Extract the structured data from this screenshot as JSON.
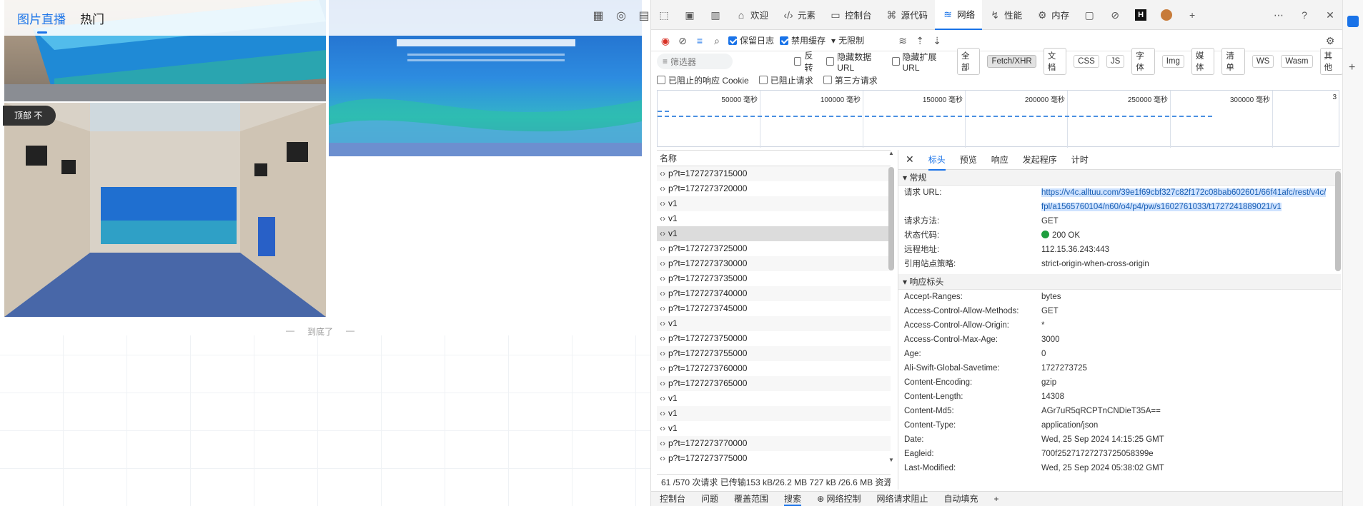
{
  "page": {
    "tabs": [
      {
        "label": "图片直播"
      },
      {
        "label": "热门"
      }
    ],
    "top_button": "顶部 不",
    "end_text": [
      "—",
      "到底了",
      "—"
    ]
  },
  "devtools": {
    "main_tabs": [
      {
        "label": "欢迎",
        "icon": "home-icon"
      },
      {
        "label": "元素",
        "icon": "code-icon"
      },
      {
        "label": "控制台",
        "icon": "console-icon"
      },
      {
        "label": "源代码",
        "icon": "sources-icon"
      },
      {
        "label": "网络",
        "icon": "wifi-icon"
      },
      {
        "label": "性能",
        "icon": "performance-icon"
      },
      {
        "label": "内存",
        "icon": "memory-icon"
      }
    ],
    "options": {
      "preserve_log": "保留日志",
      "disable_cache": "禁用缓存",
      "throttle": "无限制"
    },
    "filter_placeholder": "筛选器",
    "filter_checks": [
      "反转",
      "隐藏数据 URL",
      "隐藏扩展 URL"
    ],
    "type_chips": [
      "全部",
      "Fetch/XHR",
      "文档",
      "CSS",
      "JS",
      "字体",
      "Img",
      "媒体",
      "清单",
      "WS",
      "Wasm",
      "其他"
    ],
    "active_chip": "Fetch/XHR",
    "extra_checks": [
      "已阻止的响应 Cookie",
      "已阻止请求",
      "第三方请求"
    ],
    "timeline_ticks": [
      "50000 毫秒",
      "100000 毫秒",
      "150000 毫秒",
      "200000 毫秒",
      "250000 毫秒",
      "300000 毫秒",
      "3"
    ],
    "list_header": "名称",
    "requests": [
      "p?t=1727273715000",
      "p?t=1727273720000",
      "v1",
      "v1",
      "v1",
      "p?t=1727273725000",
      "p?t=1727273730000",
      "p?t=1727273735000",
      "p?t=1727273740000",
      "p?t=1727273745000",
      "v1",
      "p?t=1727273750000",
      "p?t=1727273755000",
      "p?t=1727273760000",
      "p?t=1727273765000",
      "v1",
      "v1",
      "v1",
      "p?t=1727273770000",
      "p?t=1727273775000"
    ],
    "selected_index": 4,
    "status_bar": "61 /570 次请求  已传输153 kB/26.2 MB  727 kB /26.6 MB 资源",
    "detail_tabs": [
      "标头",
      "预览",
      "响应",
      "发起程序",
      "计时"
    ],
    "general_title": "常规",
    "general": [
      {
        "k": "请求 URL:",
        "v": "https://v4c.alltuu.com/39e1f69cbf327c82f172c08bab602601/66f41afc/rest/v4c/fpl/a1565760104/n60/o4/p4/pw/s1602761033/t1727241889021/v1"
      },
      {
        "k": "请求方法:",
        "v": "GET"
      },
      {
        "k": "状态代码:",
        "v": "200 OK"
      },
      {
        "k": "远程地址:",
        "v": "112.15.36.243:443"
      },
      {
        "k": "引用站点策略:",
        "v": "strict-origin-when-cross-origin"
      }
    ],
    "response_title": "响应标头",
    "response": [
      {
        "k": "Accept-Ranges:",
        "v": "bytes"
      },
      {
        "k": "Access-Control-Allow-Methods:",
        "v": "GET"
      },
      {
        "k": "Access-Control-Allow-Origin:",
        "v": "*"
      },
      {
        "k": "Access-Control-Max-Age:",
        "v": "3000"
      },
      {
        "k": "Age:",
        "v": "0"
      },
      {
        "k": "Ali-Swift-Global-Savetime:",
        "v": "1727273725"
      },
      {
        "k": "Content-Encoding:",
        "v": "gzip"
      },
      {
        "k": "Content-Length:",
        "v": "14308"
      },
      {
        "k": "Content-Md5:",
        "v": "AGr7uR5qRCPTnCNDieT35A=="
      },
      {
        "k": "Content-Type:",
        "v": "application/json"
      },
      {
        "k": "Date:",
        "v": "Wed, 25 Sep 2024 14:15:25 GMT"
      },
      {
        "k": "Eagleid:",
        "v": "700f25271727273725058399e"
      },
      {
        "k": "Last-Modified:",
        "v": "Wed, 25 Sep 2024 05:38:02 GMT"
      }
    ],
    "bottom_tabs": [
      "控制台",
      "问题",
      "覆盖范围",
      "搜索",
      "网络控制",
      "网络请求阻止",
      "自动填充"
    ]
  },
  "colors": {
    "accent": "#1a73e8",
    "status_ok": "#1e9e3e"
  }
}
